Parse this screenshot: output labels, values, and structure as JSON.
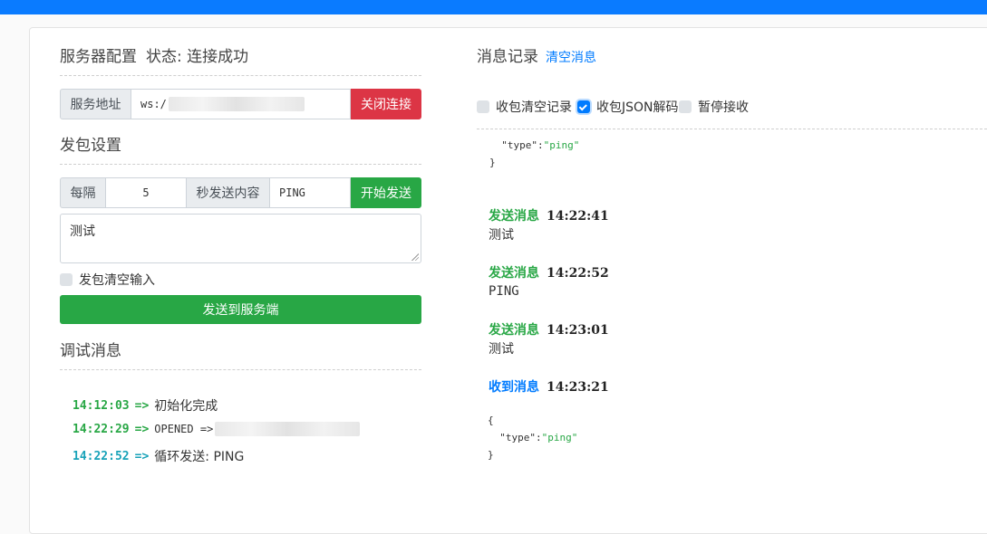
{
  "left": {
    "server_config_title": "服务器配置",
    "status_text": "状态: 连接成功",
    "server_addr_label": "服务地址",
    "server_addr_value": "ws:/",
    "close_btn": "关闭连接",
    "send_settings_title": "发包设置",
    "interval_label": "每隔",
    "interval_value": "5",
    "interval_suffix": "秒发送内容",
    "interval_content": "PING",
    "start_btn": "开始发送",
    "textarea_value": "测试",
    "clear_input_label": "发包清空输入",
    "send_btn": "发送到服务端",
    "debug_title": "调试消息",
    "debug_lines": [
      {
        "time": "14:12:03",
        "arrow": "=>",
        "text": "初始化完成"
      },
      {
        "time": "14:22:29",
        "arrow": "=>",
        "text": "OPENED =>"
      },
      {
        "time": "14:22:52",
        "arrow": "=>",
        "text": "循环发送: PING"
      }
    ]
  },
  "right": {
    "title": "消息记录",
    "clear_link": "清空消息",
    "options": [
      {
        "label": "收包清空记录",
        "checked": false
      },
      {
        "label": "收包JSON解码",
        "checked": true
      },
      {
        "label": "暂停接收",
        "checked": false
      }
    ],
    "top_code_line1_key": "\"type\"",
    "top_code_line1_val": "\"ping\"",
    "top_code_line2": "}",
    "messages": [
      {
        "kind": "发送消息",
        "time": "14:22:41",
        "body": "测试"
      },
      {
        "kind": "发送消息",
        "time": "14:22:52",
        "body": "PING"
      },
      {
        "kind": "发送消息",
        "time": "14:23:01",
        "body": "测试"
      },
      {
        "kind": "收到消息",
        "time": "14:23:21"
      }
    ],
    "json_open": "{",
    "json_key": "\"type\"",
    "json_val": "\"ping\"",
    "json_close": "}"
  },
  "colors": {
    "topbar": "#0a7bff",
    "sent": "#28a745",
    "received": "#007bff",
    "danger": "#dc3545"
  }
}
